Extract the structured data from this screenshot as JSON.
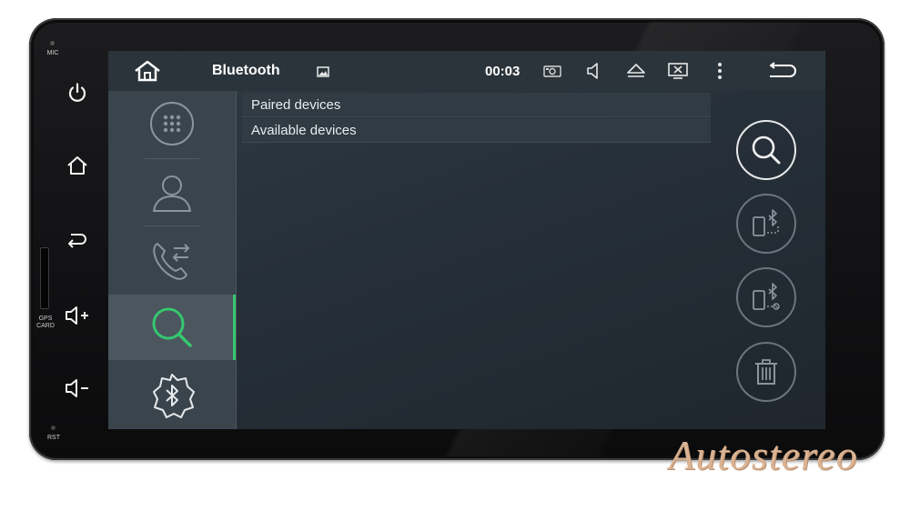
{
  "device": {
    "mic_label": "MIC",
    "gps_label_line1": "GPS",
    "gps_label_line2": "CARD",
    "rst_label": "RST",
    "hardware_buttons": [
      {
        "icon": "power-icon"
      },
      {
        "icon": "home-icon"
      },
      {
        "icon": "back-icon"
      },
      {
        "icon": "volume-up-icon"
      },
      {
        "icon": "volume-down-icon"
      }
    ]
  },
  "status_bar": {
    "title": "Bluetooth",
    "time": "00:03",
    "icons": [
      "home-icon",
      "image-icon",
      "camera-icon",
      "speaker-icon",
      "eject-icon",
      "screen-off-icon",
      "more-icon",
      "back-icon"
    ]
  },
  "nav": {
    "items": [
      {
        "icon": "dialpad-icon",
        "active": false
      },
      {
        "icon": "contacts-icon",
        "active": false
      },
      {
        "icon": "call-log-icon",
        "active": false
      },
      {
        "icon": "search-icon",
        "active": true
      },
      {
        "icon": "bluetooth-settings-icon",
        "active": false
      }
    ]
  },
  "device_list": {
    "sections": [
      {
        "label": "Paired devices"
      },
      {
        "label": "Available devices"
      }
    ]
  },
  "actions": [
    {
      "icon": "search-icon"
    },
    {
      "icon": "phone-bluetooth-connect-icon"
    },
    {
      "icon": "phone-bluetooth-disconnect-icon"
    },
    {
      "icon": "trash-icon"
    }
  ],
  "watermark": "Autostereo",
  "colors": {
    "accent": "#35c76f",
    "screen_bg": "#27313a",
    "nav_bg": "#39444d",
    "watermark": "#d9b393"
  }
}
